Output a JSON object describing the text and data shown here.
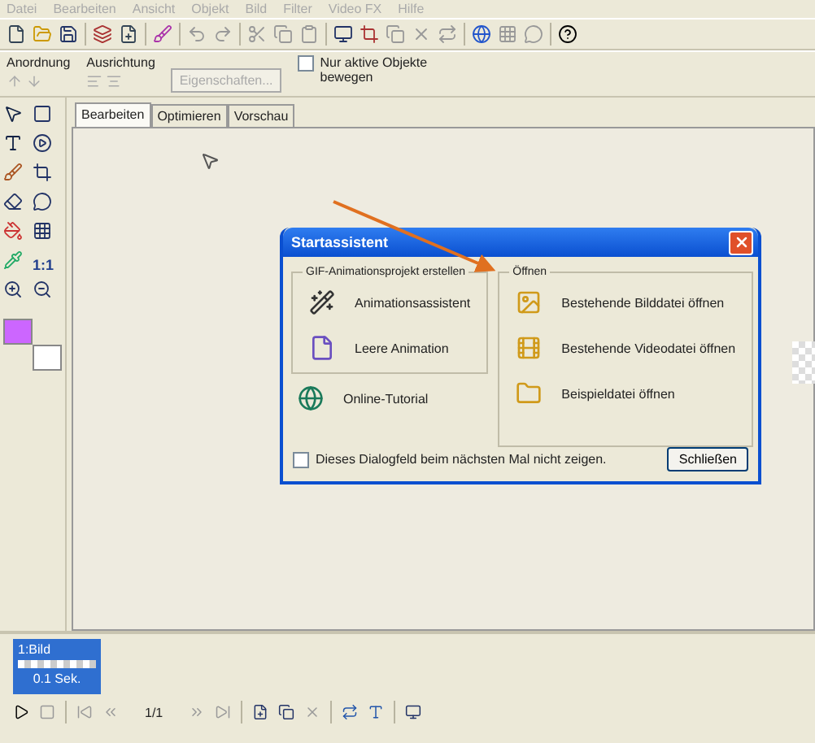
{
  "menu": [
    "Datei",
    "Bearbeiten",
    "Ansicht",
    "Objekt",
    "Bild",
    "Filter",
    "Video FX",
    "Hilfe"
  ],
  "arrange": {
    "order_label": "Anordnung",
    "align_label": "Ausrichtung",
    "properties_button": {
      "label": "Eigenschaften...",
      "disabled": true
    },
    "active_only": {
      "label": "Nur aktive Objekte bewegen",
      "checked": false
    }
  },
  "tools": {
    "zoom_ratio": "1:1"
  },
  "tabs": [
    {
      "label": "Bearbeiten",
      "selected": true
    },
    {
      "label": "Optimieren",
      "selected": false
    },
    {
      "label": "Vorschau",
      "selected": false
    }
  ],
  "dialog": {
    "title": "Startassistent",
    "create_group": {
      "legend": "GIF-Animationsprojekt erstellen",
      "items": [
        {
          "kind": "wizard",
          "label": "Animationsassistent"
        },
        {
          "kind": "blank",
          "label": "Leere Animation"
        }
      ]
    },
    "tutorial": {
      "kind": "web",
      "label": "Online-Tutorial"
    },
    "open_group": {
      "legend": "Öffnen",
      "items": [
        {
          "kind": "image",
          "label": "Bestehende Bilddatei öffnen"
        },
        {
          "kind": "video",
          "label": "Bestehende Videodatei öffnen"
        },
        {
          "kind": "sample",
          "label": "Beispieldatei öffnen"
        }
      ]
    },
    "dont_show": {
      "label": "Dieses Dialogfeld beim nächsten Mal nicht zeigen.",
      "checked": false
    },
    "close_button": "Schließen"
  },
  "frames": [
    {
      "label": "1:Bild",
      "duration": "0.1 Sek.",
      "selected": true
    }
  ],
  "counter": "1/1"
}
